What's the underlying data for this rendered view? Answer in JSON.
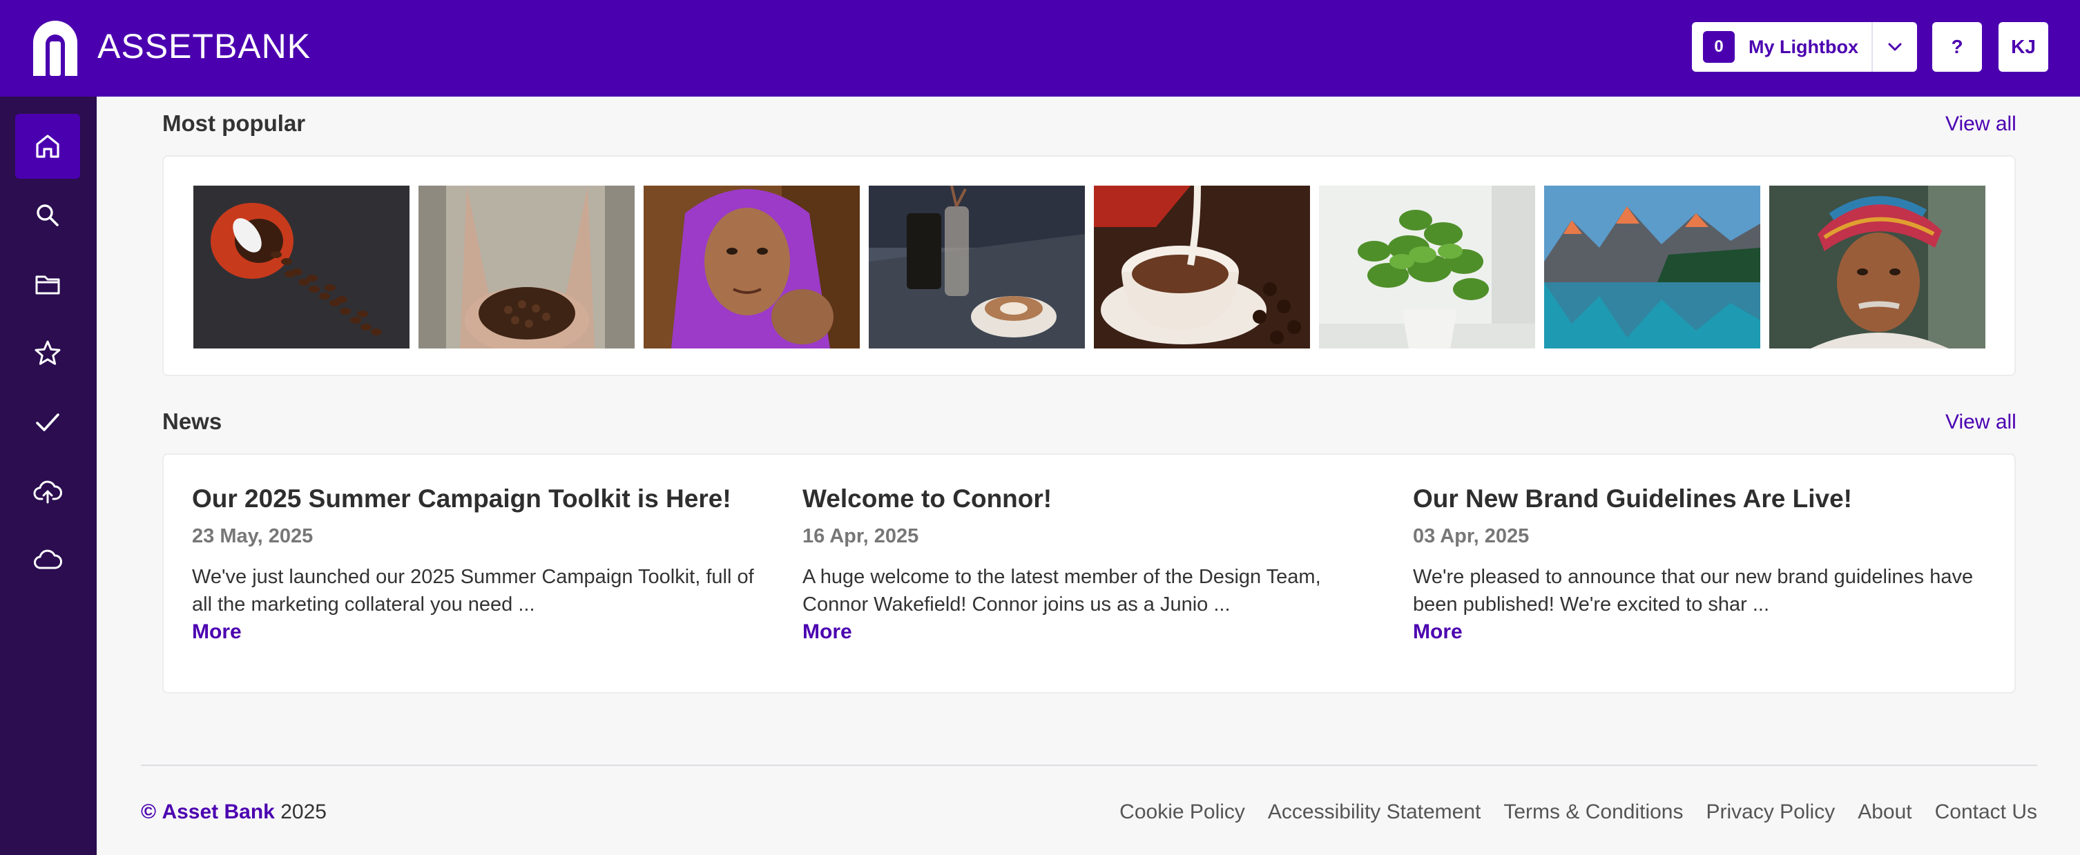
{
  "header": {
    "brand": "ASSETBANK",
    "lightbox_count": "0",
    "lightbox_label": "My Lightbox",
    "help_label": "?",
    "user_initials": "KJ",
    "colors": {
      "brand": "#4b00b0",
      "sidebar": "#2b0d50"
    }
  },
  "sidebar": {
    "items": [
      {
        "name": "home",
        "icon": "home-icon",
        "active": true
      },
      {
        "name": "search",
        "icon": "search-icon",
        "active": false
      },
      {
        "name": "folders",
        "icon": "folder-icon",
        "active": false
      },
      {
        "name": "favorites",
        "icon": "star-icon",
        "active": false
      },
      {
        "name": "approvals",
        "icon": "check-icon",
        "active": false
      },
      {
        "name": "upload",
        "icon": "cloud-upload-icon",
        "active": false
      },
      {
        "name": "cloud",
        "icon": "cloud-icon",
        "active": false
      }
    ]
  },
  "popular": {
    "title": "Most popular",
    "view_all": "View all",
    "images": [
      "coffee-cup-spilled-beans",
      "hands-holding-coffee-beans",
      "woman-purple-headscarf",
      "cafe-table-latte",
      "coffee-cup-milk-pour",
      "potted-green-plant",
      "mountain-lake",
      "man-red-turban"
    ]
  },
  "news": {
    "title": "News",
    "view_all": "View all",
    "items": [
      {
        "title": "Our 2025 Summer Campaign Toolkit is Here!",
        "date": "23 May, 2025",
        "excerpt": "We've just launched our 2025 Summer Campaign Toolkit, full of all the marketing collateral you need ...",
        "more": "More"
      },
      {
        "title": "Welcome to Connor!",
        "date": "16 Apr, 2025",
        "excerpt": "A huge welcome to the latest member of the Design Team, Connor Wakefield! Connor joins us as a Junio ...",
        "more": "More"
      },
      {
        "title": "Our New Brand Guidelines Are Live!",
        "date": "03 Apr, 2025",
        "excerpt": "We're pleased to announce that our new brand guidelines have been published! We're excited to shar ...",
        "more": "More"
      }
    ]
  },
  "footer": {
    "copyright_symbol": "©",
    "copyright_brand": "Asset Bank",
    "copyright_year": "2025",
    "links": [
      "Cookie Policy",
      "Accessibility Statement",
      "Terms & Conditions",
      "Privacy Policy",
      "About",
      "Contact Us"
    ]
  }
}
